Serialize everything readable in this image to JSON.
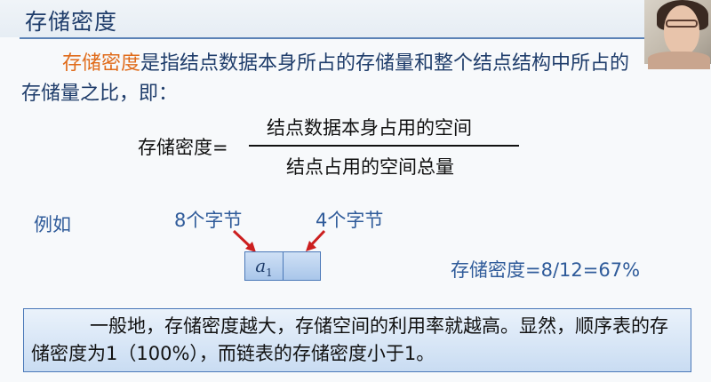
{
  "slide": {
    "title": "存储密度",
    "intro": {
      "highlight": "存储密度",
      "rest": "是指结点数据本身所占的存储量和整个结点结构中所占的存储量之比，即："
    },
    "formula": {
      "lhs": "存储密度=",
      "numerator": "结点数据本身占用的空间",
      "denominator": "结点占用的空间总量"
    },
    "example": {
      "label": "例如",
      "data_bytes": "8个字节",
      "pointer_bytes": "4个字节",
      "cell_var": "a",
      "cell_sub": "1",
      "result": "存储密度=8/12=67%"
    },
    "note": "一般地，存储密度越大，存储空间的利用率就越高。显然，顺序表的存储密度为1（100%），而链表的存储密度小于1。"
  },
  "colors": {
    "title": "#1f3d6b",
    "highlight": "#e06b1a",
    "accent_text": "#2f5b9a",
    "arrow": "#cc1f1f",
    "node_border": "#4a78b8"
  }
}
